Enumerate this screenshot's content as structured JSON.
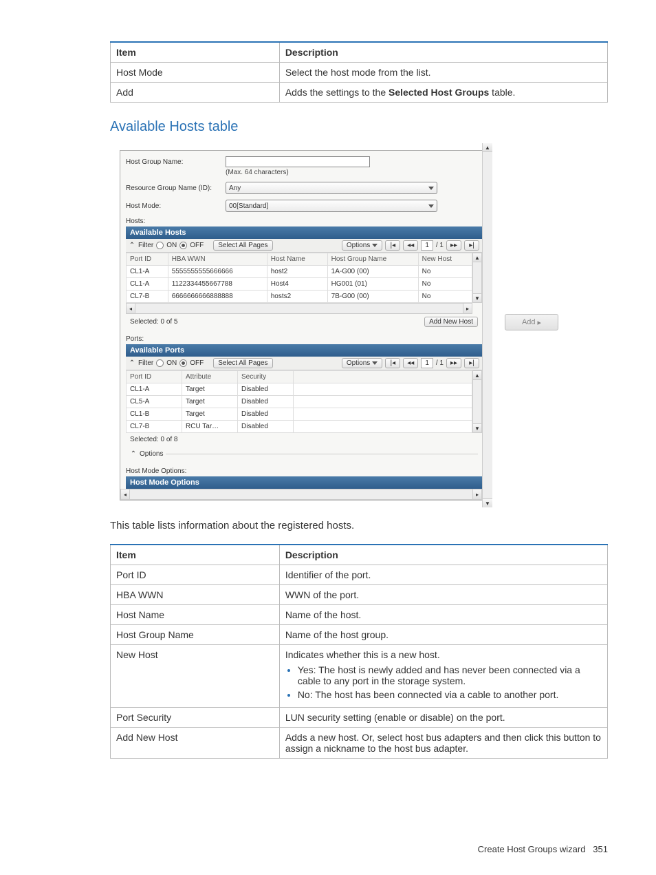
{
  "table1": {
    "headers": [
      "Item",
      "Description"
    ],
    "rows": [
      {
        "item": "Host Mode",
        "desc": "Select the host mode from the list."
      },
      {
        "item": "Add",
        "desc_pre": "Adds the settings to the ",
        "desc_bold": "Selected Host Groups",
        "desc_post": " table."
      }
    ]
  },
  "section_heading": "Available Hosts table",
  "body_text": "This table lists information about the registered hosts.",
  "table2": {
    "headers": [
      "Item",
      "Description"
    ],
    "rows": {
      "port_id": {
        "item": "Port ID",
        "desc": "Identifier of the port."
      },
      "hba_wwn": {
        "item": "HBA WWN",
        "desc": "WWN of the port."
      },
      "host_name": {
        "item": "Host Name",
        "desc": "Name of the host."
      },
      "host_group_name": {
        "item": "Host Group Name",
        "desc": "Name of the host group."
      },
      "new_host": {
        "item": "New Host",
        "desc_intro": "Indicates whether this is a new host.",
        "bullet_yes": "Yes: The host is newly added and has never been connected via a cable to any port in the storage system.",
        "bullet_no": "No: The host has been connected via a cable to another port."
      },
      "port_security": {
        "item": "Port Security",
        "desc": "LUN security setting (enable or disable) on the port."
      },
      "add_new_host": {
        "item": "Add New Host",
        "desc": "Adds a new host. Or, select host bus adapters and then click this button to assign a nickname to the host bus adapter."
      }
    }
  },
  "footer": {
    "text": "Create Host Groups wizard",
    "page": "351"
  },
  "screenshot": {
    "labels": {
      "host_group_name": "Host Group Name:",
      "max_chars": "(Max. 64 characters)",
      "resource_group": "Resource Group Name (ID):",
      "resource_group_value": "Any",
      "host_mode": "Host Mode:",
      "host_mode_value": "00[Standard]",
      "hosts_label": "Hosts:",
      "ports_label": "Ports:",
      "available_hosts": "Available Hosts",
      "available_ports": "Available Ports",
      "host_mode_options": "Host Mode Options",
      "host_mode_options_label": "Host Mode Options:",
      "filter": "Filter",
      "on": "ON",
      "off": "OFF",
      "select_all_pages": "Select All Pages",
      "options": "Options",
      "page_indicator": "/ 1",
      "page_current": "1",
      "selected_hosts": "Selected: 0   of 5",
      "selected_ports": "Selected: 0   of 8",
      "add_new_host_btn": "Add New Host",
      "add_btn": "Add"
    },
    "hosts_columns": [
      "Port ID",
      "HBA WWN",
      "Host Name",
      "Host Group Name",
      "New Host"
    ],
    "hosts_rows": [
      {
        "port": "CL1-A",
        "wwn": "5555555555666666",
        "name": "host2",
        "group": "1A-G00 (00)",
        "new": "No"
      },
      {
        "port": "CL1-A",
        "wwn": "1122334455667788",
        "name": "Host4",
        "group": "HG001 (01)",
        "new": "No"
      },
      {
        "port": "CL7-B",
        "wwn": "6666666666888888",
        "name": "hosts2",
        "group": "7B-G00 (00)",
        "new": "No"
      }
    ],
    "ports_columns": [
      "Port ID",
      "Attribute",
      "Security"
    ],
    "ports_rows": [
      {
        "port": "CL1-A",
        "attr": "Target",
        "sec": "Disabled"
      },
      {
        "port": "CL5-A",
        "attr": "Target",
        "sec": "Disabled"
      },
      {
        "port": "CL1-B",
        "attr": "Target",
        "sec": "Disabled"
      },
      {
        "port": "CL7-B",
        "attr": "RCU Tar…",
        "sec": "Disabled"
      }
    ]
  }
}
